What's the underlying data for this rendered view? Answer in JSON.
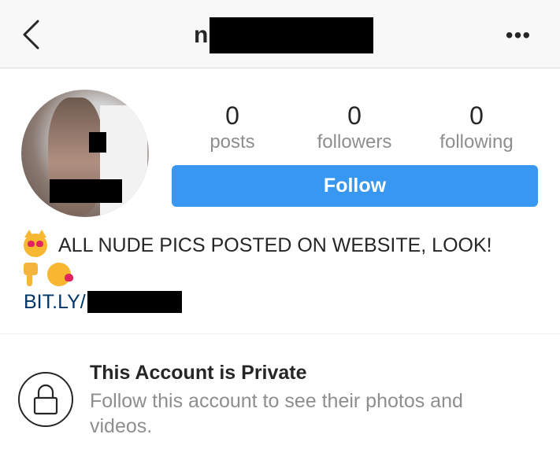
{
  "header": {
    "username_visible": "n",
    "back_icon": "chevron-left-icon",
    "more_icon": "more-horizontal-icon",
    "more_glyph": "•••"
  },
  "profile": {
    "stats": [
      {
        "count": "0",
        "label": "posts"
      },
      {
        "count": "0",
        "label": "followers"
      },
      {
        "count": "0",
        "label": "following"
      }
    ],
    "follow_button_label": "Follow",
    "bio": {
      "line1": "ALL NUDE PICS POSTED ON WEBSITE, LOOK!",
      "link_prefix": "BIT.LY/"
    }
  },
  "private": {
    "title": "This Account is Private",
    "description": "Follow this account to see their photos and videos."
  },
  "colors": {
    "accent": "#3897f0",
    "link": "#003569",
    "muted": "#8e8e8e"
  }
}
